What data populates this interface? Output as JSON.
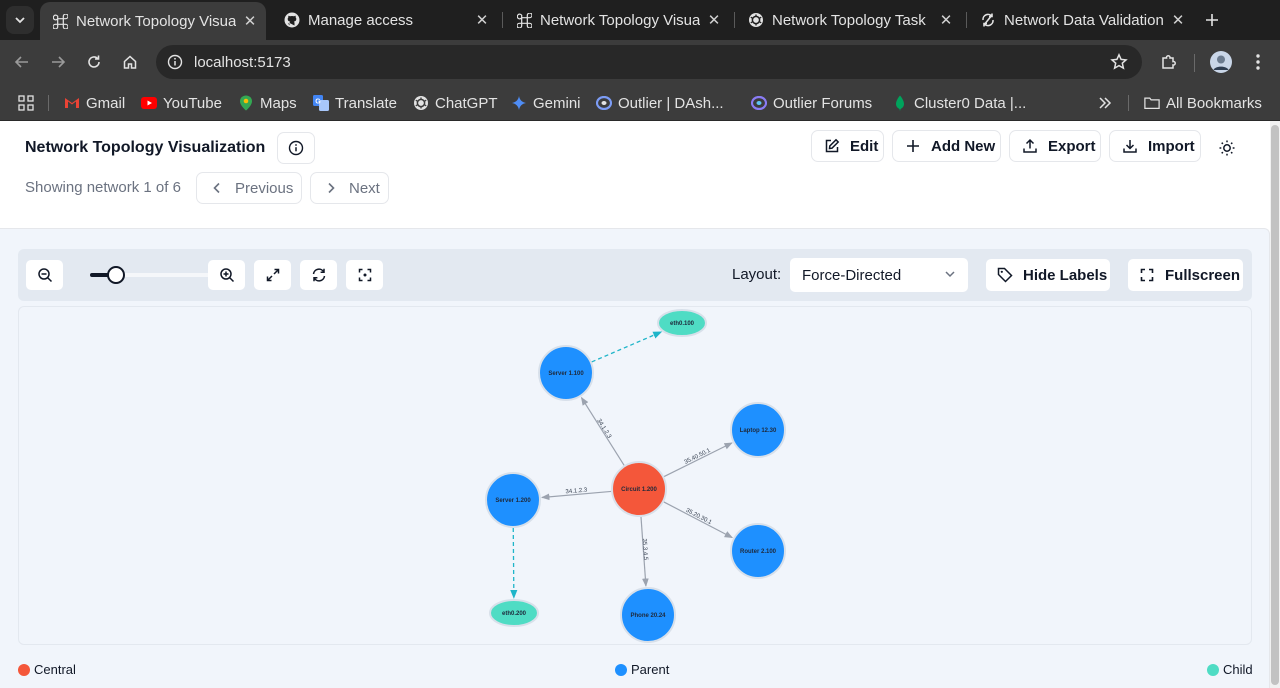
{
  "browser": {
    "tabs": [
      {
        "title": "Network Topology Visualization",
        "icon": "command-icon",
        "active": true
      },
      {
        "title": "Manage access",
        "icon": "github-icon",
        "active": false
      },
      {
        "title": "Network Topology Visualization",
        "icon": "command-icon",
        "active": false
      },
      {
        "title": "Network Topology Task",
        "icon": "chatgpt-icon",
        "active": false
      },
      {
        "title": "Network Data Validation",
        "icon": "sync-icon",
        "active": false
      }
    ],
    "url": "localhost:5173",
    "bookmarks": [
      {
        "label": "Gmail",
        "icon": "gmail-icon",
        "color": "#ea4335"
      },
      {
        "label": "YouTube",
        "icon": "youtube-icon",
        "color": "#ff0000"
      },
      {
        "label": "Maps",
        "icon": "maps-icon",
        "color": "#34a853"
      },
      {
        "label": "Translate",
        "icon": "translate-icon",
        "color": "#4285f4"
      },
      {
        "label": "ChatGPT",
        "icon": "chatgpt-icon",
        "color": "#e3e3e3"
      },
      {
        "label": "Gemini",
        "icon": "gemini-icon",
        "color": "#4f8df5"
      },
      {
        "label": "Outlier | DAsh...",
        "icon": "outlier-icon",
        "color": "#7c9cf5"
      },
      {
        "label": "Outlier Forums",
        "icon": "outlier-forums-icon",
        "color": "#8a7cf5"
      },
      {
        "label": "Cluster0 Data |...",
        "icon": "mongodb-icon",
        "color": "#00a35c"
      }
    ],
    "all_bookmarks": "All Bookmarks"
  },
  "header": {
    "title": "Network Topology Visualization",
    "showing": "Showing network 1 of 6",
    "previous": "Previous",
    "next": "Next",
    "actions": {
      "edit": "Edit",
      "add_new": "Add New",
      "export": "Export",
      "import": "Import"
    }
  },
  "controls": {
    "zoom_level": 0.2,
    "layout_label": "Layout:",
    "layout_value": "Force-Directed",
    "hide_labels": "Hide Labels",
    "fullscreen": "Fullscreen"
  },
  "colors": {
    "central": "#f4573a",
    "parent": "#1e90ff",
    "child": "#4fdcc4",
    "child_edge": "#1fb5c9"
  },
  "graph": {
    "nodes": [
      {
        "id": "circuit",
        "label": "Circuit 1.200",
        "type": "central"
      },
      {
        "id": "server100",
        "label": "Server 1.100",
        "type": "parent"
      },
      {
        "id": "laptop",
        "label": "Laptop 12.30",
        "type": "parent"
      },
      {
        "id": "server200",
        "label": "Server 1.200",
        "type": "parent"
      },
      {
        "id": "router",
        "label": "Router 2.100",
        "type": "parent"
      },
      {
        "id": "phone",
        "label": "Phone 20.24",
        "type": "parent"
      },
      {
        "id": "eth100",
        "label": "eth0.100",
        "type": "child"
      },
      {
        "id": "eth200",
        "label": "eth0.200",
        "type": "child"
      }
    ],
    "edges": [
      {
        "from": "circuit",
        "to": "server100",
        "label": "34.1.2.3",
        "kind": "link"
      },
      {
        "from": "circuit",
        "to": "laptop",
        "label": "35.40.50.1",
        "kind": "link"
      },
      {
        "from": "circuit",
        "to": "server200",
        "label": "34.1.2.3",
        "kind": "link"
      },
      {
        "from": "circuit",
        "to": "router",
        "label": "35.20.30.1",
        "kind": "link"
      },
      {
        "from": "circuit",
        "to": "phone",
        "label": "35.3.4.5",
        "kind": "link"
      },
      {
        "from": "server100",
        "to": "eth100",
        "label": "",
        "kind": "child"
      },
      {
        "from": "server200",
        "to": "eth200",
        "label": "",
        "kind": "child"
      }
    ]
  },
  "legend": {
    "central": "Central",
    "parent": "Parent",
    "child": "Child"
  }
}
